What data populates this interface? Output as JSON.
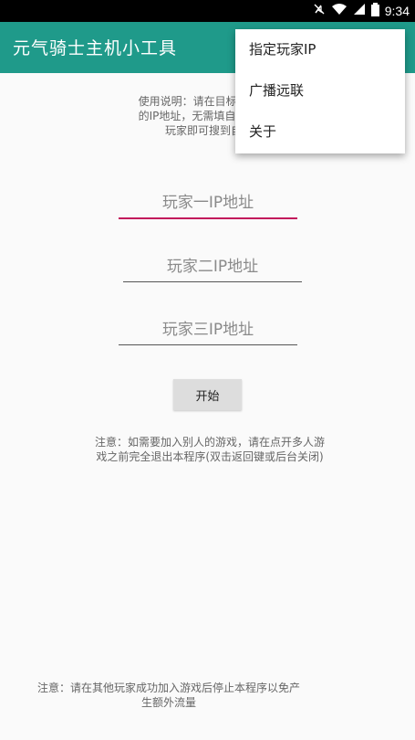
{
  "status_bar": {
    "time": "9:34",
    "icons": [
      "mute-icon",
      "wifi-icon",
      "signal-icon",
      "battery-icon"
    ]
  },
  "app_bar": {
    "title": "元气骑士主机小工具",
    "color": "#1f9a8a"
  },
  "menu": {
    "items": [
      {
        "label": "指定玩家IP"
      },
      {
        "label": "广播远联"
      },
      {
        "label": "关于"
      }
    ]
  },
  "instructions": {
    "lines": [
      "使用说明：请在目标IP处填写",
      "的IP地址，无需填自己的地址",
      "玩家即可搜到自己"
    ]
  },
  "inputs": [
    {
      "placeholder": "玩家一IP地址",
      "value": "",
      "focused": true
    },
    {
      "placeholder": "玩家二IP地址",
      "value": ""
    },
    {
      "placeholder": "玩家三IP地址",
      "value": ""
    }
  ],
  "start_button": {
    "label": "开始"
  },
  "note1": {
    "lines": [
      "注意：如需要加入别人的游戏，请在点开多人游",
      "戏之前完全退出本程序(双击返回键或后台关闭)"
    ]
  },
  "note2": {
    "lines": [
      "注意：请在其他玩家成功加入游戏后停止本程序以免产",
      "生额外流量"
    ]
  },
  "colors": {
    "accent": "#c2185b",
    "primary": "#1f9a8a"
  }
}
